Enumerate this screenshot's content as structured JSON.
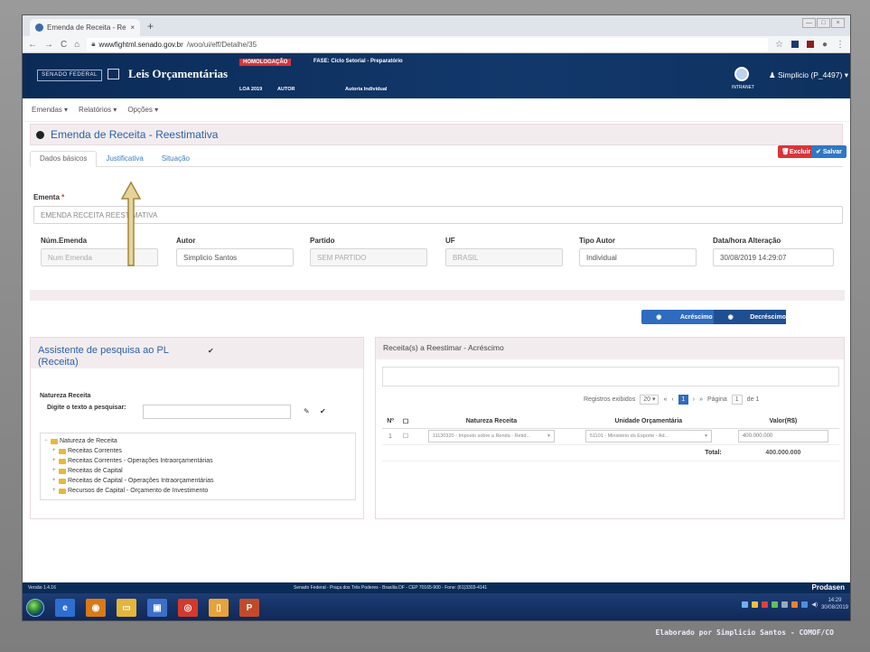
{
  "browser": {
    "tab_title": "Emenda de Receita - Reestimati",
    "url_host": "wwwfightml.senado.gov.br",
    "url_path": "/woo/ui/eff/Detalhe/35"
  },
  "header": {
    "senado_label": "SENADO FEDERAL",
    "app_name": "Leis Orçamentárias",
    "homolog_label": "HOMOLOGAÇÃO",
    "fase_label": "FASE: Ciclo Setorial - Preparatório",
    "loa_label": "LOA 2019",
    "autor_label": "AUTOR",
    "autor_value": "Autoria Individual",
    "intranet_label": "INTRANET",
    "user_label": "Simplicio (P_4497)"
  },
  "menu": {
    "items": [
      "Emendas",
      "Relatórios",
      "Opções"
    ]
  },
  "page": {
    "title": "Emenda de Receita - Reestimativa",
    "delete_label": "Excluir",
    "save_label": "Salvar",
    "tabs": [
      "Dados básicos",
      "Justificativa",
      "Situação"
    ]
  },
  "form": {
    "ementa_label": "Ementa",
    "ementa_value": "EMENDA RECEITA REESTIMATIVA",
    "num_label": "Núm.Emenda",
    "num_placeholder": "Num Emenda",
    "autor_label": "Autor",
    "autor_value": "Simplicio Santos",
    "partido_label": "Partido",
    "partido_value": "SEM PARTIDO",
    "uf_label": "UF",
    "uf_value": "BRASIL",
    "tipo_label": "Tipo Autor",
    "tipo_value": "Individual",
    "data_label": "Data/hora Alteração",
    "data_value": "30/08/2019 14:29:07"
  },
  "toggle": {
    "acrescimo": "Acréscimo",
    "decrescimo": "Decréscimo"
  },
  "assistant": {
    "title_line1": "Assistente de pesquisa ao PL",
    "title_line2": "(Receita)",
    "natureza_label": "Natureza Receita",
    "search_label": "Digite o texto a pesquisar:",
    "tree": [
      "Natureza de Receita",
      "Receitas Correntes",
      "Receitas Correntes - Operações Intraorçamentárias",
      "Receitas de Capital",
      "Receitas de Capital - Operações Intraorçamentárias",
      "Recursos de Capital - Orçamento de Investimento"
    ]
  },
  "results": {
    "title": "Receita(s) a Reestimar - Acréscimo",
    "registros_label": "Registros exibidos",
    "registros_value": "20",
    "page_current": "1",
    "pagina_label": "Página",
    "pagina_value": "1",
    "pagina_of": "de 1",
    "columns": [
      "Nº",
      "",
      "Natureza Receita",
      "Unidade Orçamentária",
      "Valor(R$)"
    ],
    "rows": [
      {
        "n": "1",
        "natureza": "11130320 - Imposto sobre a Renda - Retid...",
        "unidade": "51101 - Ministério do Esporte - Ad...",
        "valor": "400.000.000"
      }
    ],
    "total_label": "Total:",
    "total_value": "400.000.000"
  },
  "footer": {
    "version": "Versão 1.4.16",
    "address": "Senado Federal - Praça dos Três Poderes - Brasília DF - CEP 70165-900 - Fone: (61)3303-4141",
    "brand": "Prodasen"
  },
  "taskbar": {
    "time": "14:29",
    "date": "30/08/2019"
  },
  "credit": "Elaborado por Simplicio Santos - COMOF/CO"
}
